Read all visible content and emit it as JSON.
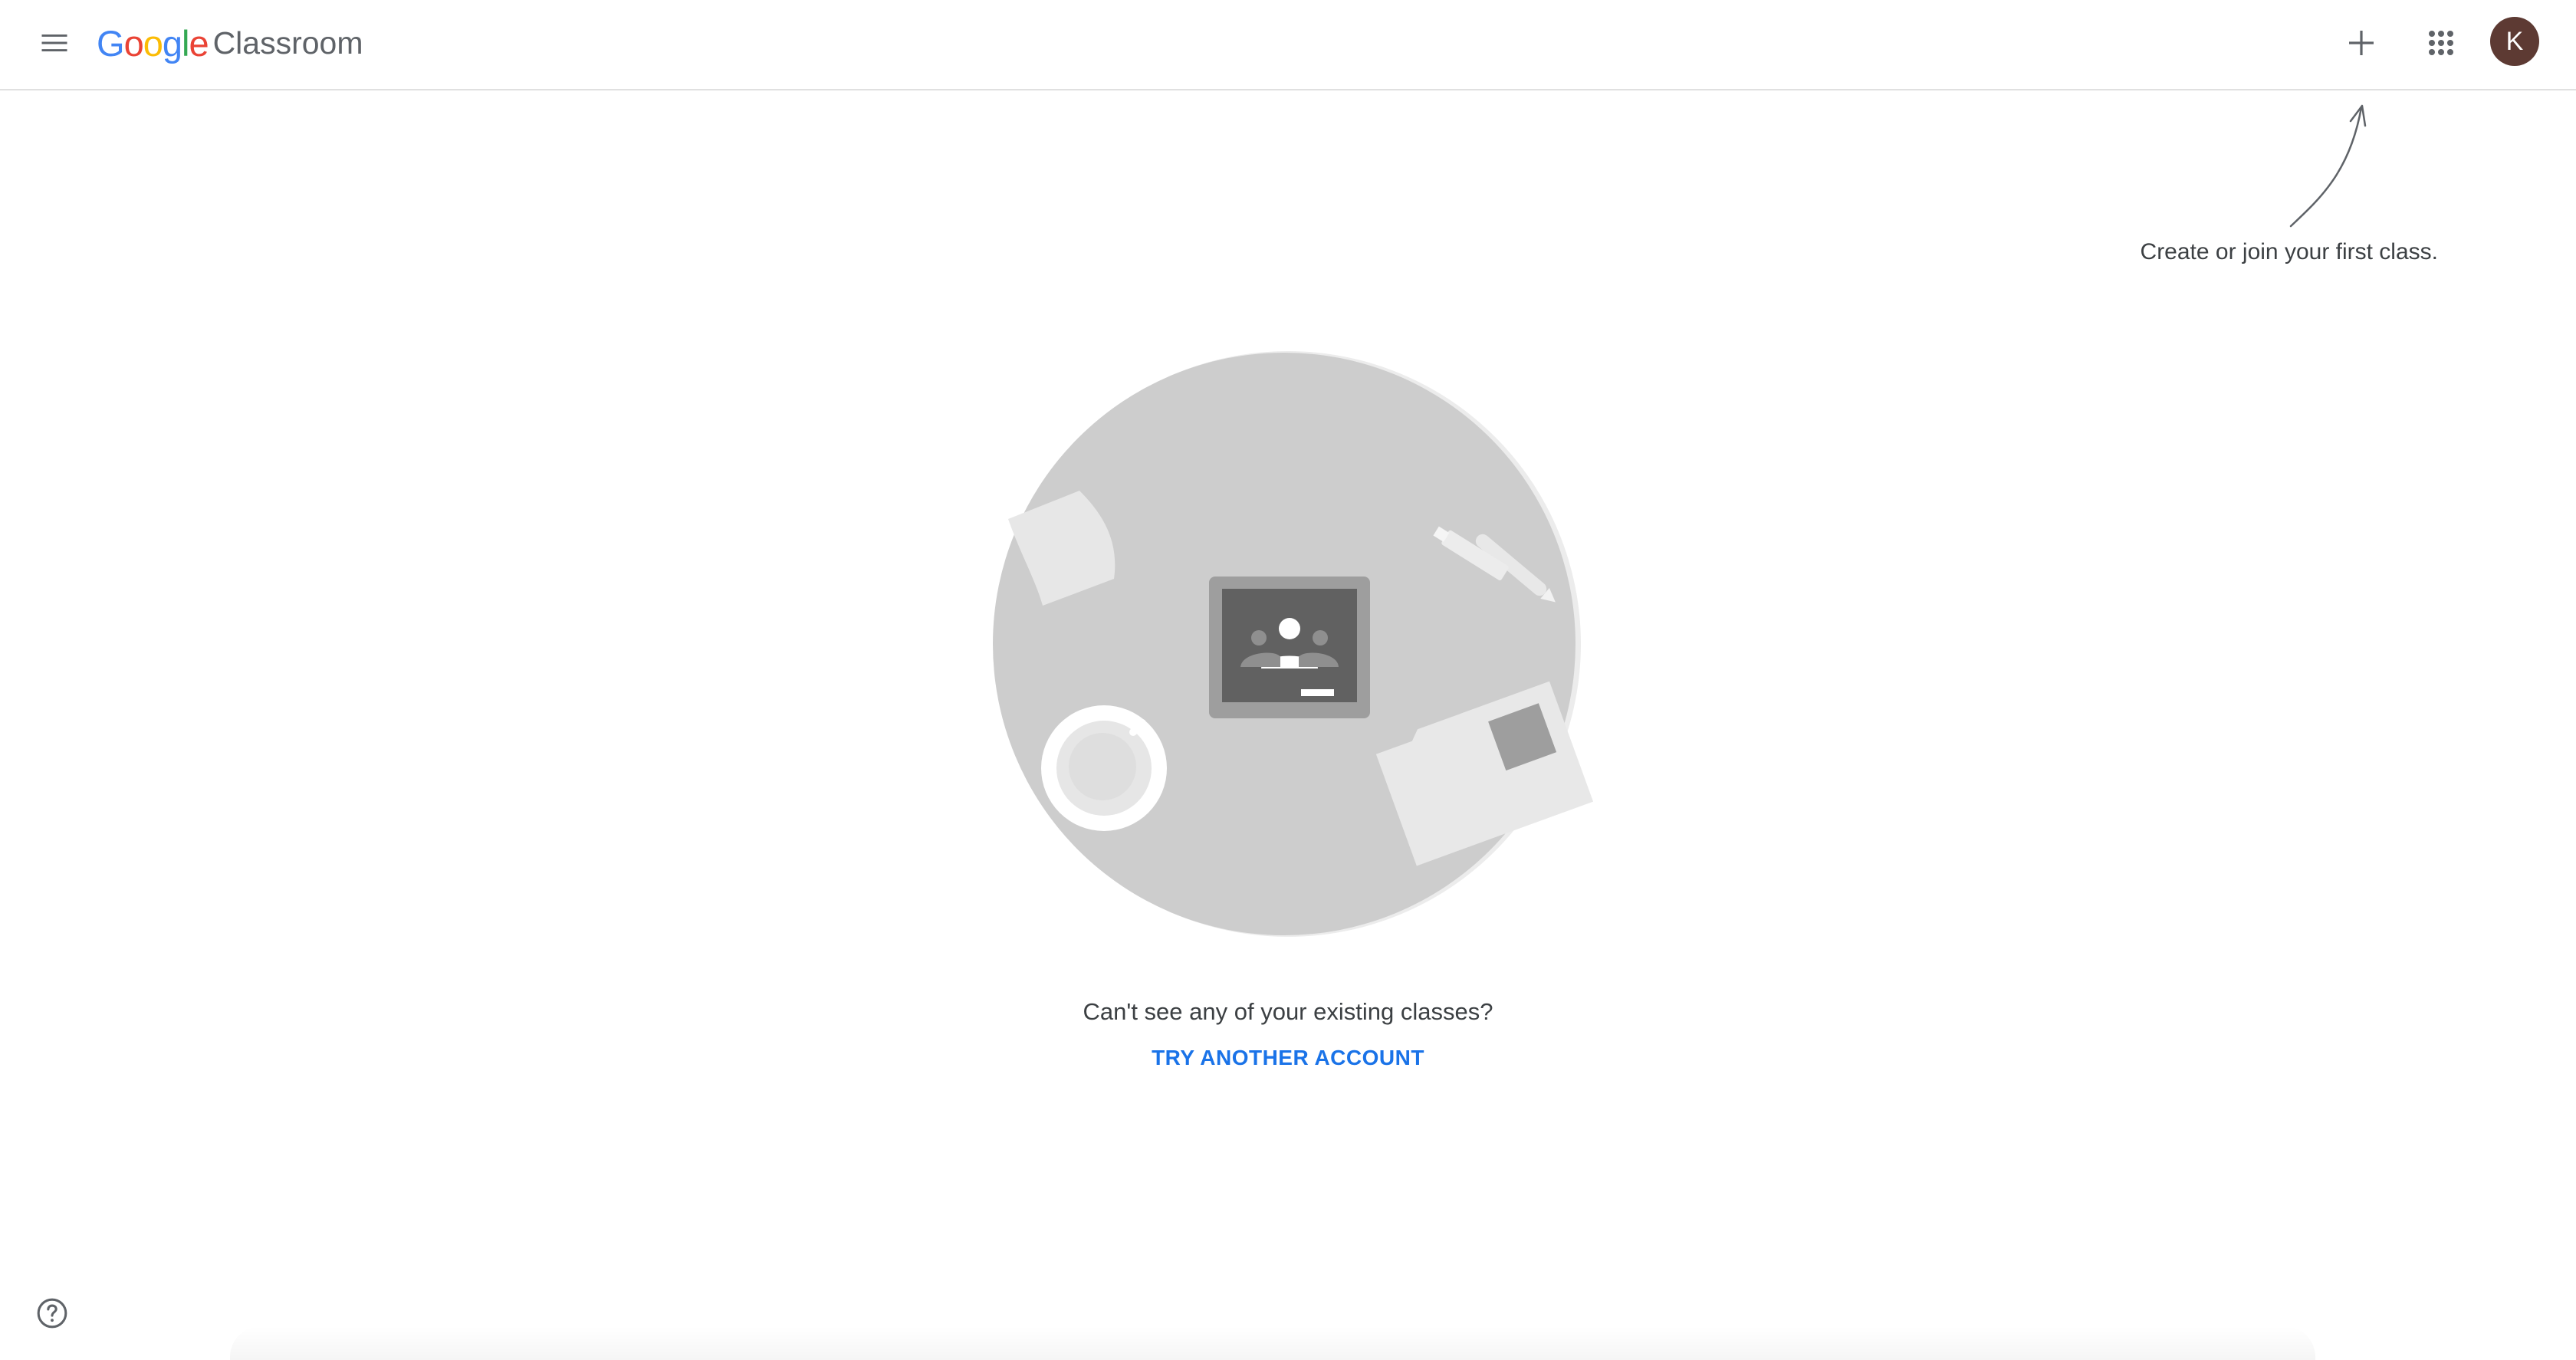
{
  "header": {
    "logo": {
      "google_letters": [
        "G",
        "o",
        "o",
        "g",
        "l",
        "e"
      ],
      "google_colors": [
        "#4285F4",
        "#EA4335",
        "#FBBC05",
        "#4285F4",
        "#34A853",
        "#EA4335"
      ],
      "product": "Classroom"
    },
    "menu_icon": "menu-icon",
    "add_icon": "plus-icon",
    "apps_icon": "apps-grid-icon",
    "avatar": {
      "initial": "K",
      "color": "#5d3a33"
    }
  },
  "hint": {
    "text": "Create or join your first class."
  },
  "empty_state": {
    "message": "Can't see any of your existing classes?",
    "link_label": "TRY ANOTHER ACCOUNT",
    "link_color": "#1a73e8"
  },
  "footer": {
    "help_icon": "help-icon"
  }
}
